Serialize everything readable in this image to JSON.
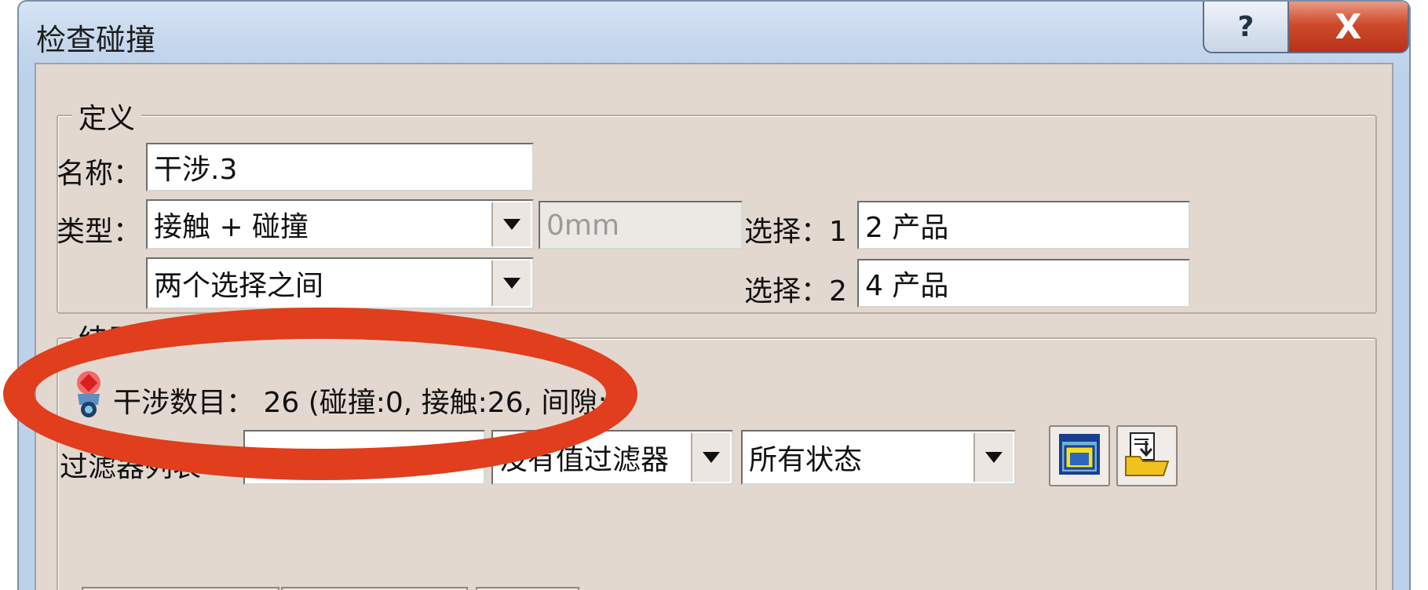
{
  "window": {
    "title": "检查碰撞",
    "help_label": "?",
    "close_label": "X"
  },
  "definition": {
    "legend": "定义",
    "name_label": "名称：",
    "name_value": "干涉.3",
    "type_label": "类型：",
    "type_value": "接触 + 碰撞",
    "clearance_value": "0mm",
    "scope_value": "两个选择之间",
    "selection1_label": "选择：1",
    "selection1_value": "2 产品",
    "selection2_label": "选择：2",
    "selection2_value": "4 产品"
  },
  "result": {
    "legend": "结果",
    "summary": "干涉数目： 26 (碰撞:0, 接触:26, 间隙:0",
    "filter_label": "过滤器列表",
    "value_filter": "没有值过滤器",
    "status_filter": "所有状态"
  },
  "icons": {
    "interference": "interference-status-icon",
    "preview": "preview-window-icon",
    "export": "export-folder-icon"
  },
  "colors": {
    "annotation": "#e03e1c",
    "titlebar": "#c3d6ec",
    "client": "#e3d8cf"
  }
}
